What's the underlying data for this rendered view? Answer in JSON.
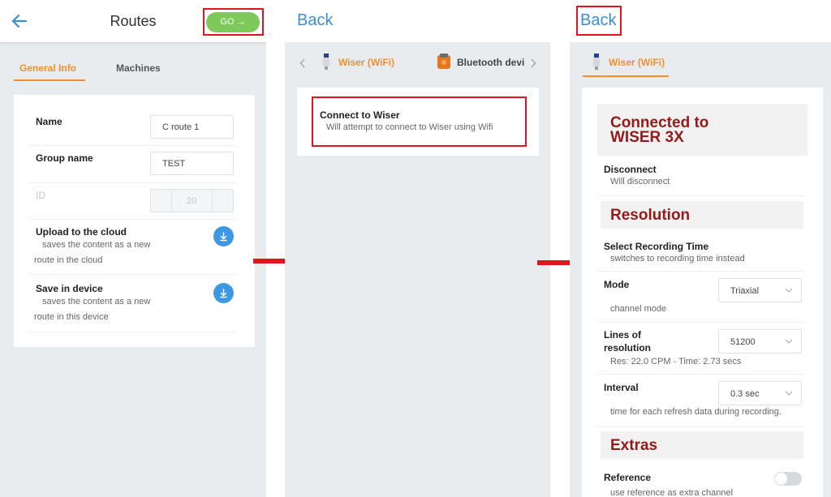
{
  "screen1": {
    "title": "Routes",
    "go_label": "GO →",
    "tabs": [
      {
        "label": "General Info",
        "active": true
      },
      {
        "label": "Machines",
        "active": false
      }
    ],
    "name_label": "Name",
    "name_value": "C route 1",
    "group_label": "Group name",
    "group_value": "TEST",
    "id_label": "ID",
    "id_value": "20",
    "upload_title": "Upload to the cloud",
    "upload_desc1": "saves the content as a new",
    "upload_desc2": "route in the cloud",
    "save_title": "Save in device",
    "save_desc1": "saves the content as a new",
    "save_desc2": "route in this device"
  },
  "screen2": {
    "back_label": "Back",
    "tab_wifi": "Wiser (WiFi)",
    "tab_bluetooth": "Bluetooth devi",
    "connect_title": "Connect to Wiser",
    "connect_desc": "Will attempt to connect to Wiser using Wifi"
  },
  "screen3": {
    "back_label": "Back",
    "tab_wifi": "Wiser (WiFi)",
    "connected_line1": "Connected to",
    "connected_line2": "WISER 3X",
    "disconnect_title": "Disconnect",
    "disconnect_desc": "Will disconnect",
    "resolution_heading": "Resolution",
    "recording_title": "Select Recording Time",
    "recording_desc": "switches to recording time instead",
    "mode_label": "Mode",
    "mode_value": "Triaxial",
    "mode_desc": "channel mode",
    "lines_label1": "Lines of",
    "lines_label2": "resolution",
    "lines_value": "51200",
    "lines_desc": "Res: 22.0 CPM - Time: 2.73 secs",
    "interval_label": "Interval",
    "interval_value": "0.3 sec",
    "interval_desc": "time for each refresh data during recording.",
    "extras_heading": "Extras",
    "reference_label": "Reference",
    "reference_desc": "use reference as extra channel",
    "reference_on": false
  },
  "colors": {
    "accent_orange": "#ef8f2f",
    "link_blue": "#3b8fd0",
    "go_green": "#7dca5a",
    "highlight_red": "#e0161e",
    "heading_maroon": "#961a1a"
  }
}
